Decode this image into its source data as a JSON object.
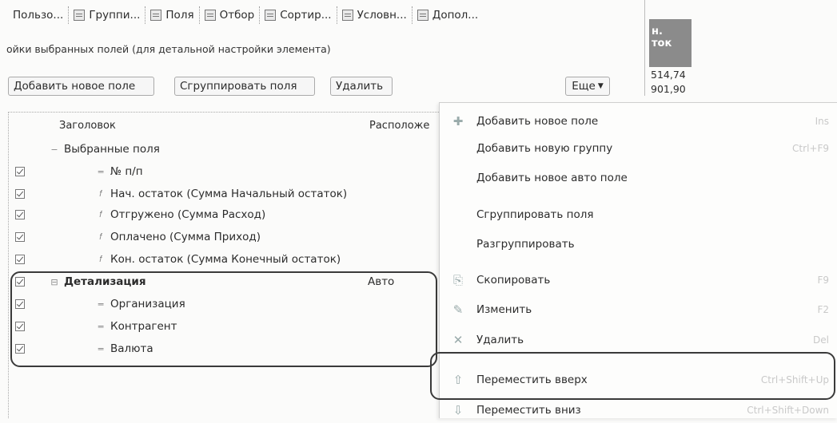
{
  "tabs": [
    {
      "label": "Пользо...",
      "icon": "user-icon"
    },
    {
      "label": "Группи...",
      "icon": "grouping-icon"
    },
    {
      "label": "Поля",
      "icon": "fields-icon"
    },
    {
      "label": "Отбор",
      "icon": "filter-icon"
    },
    {
      "label": "Сортир...",
      "icon": "sort-icon"
    },
    {
      "label": "Условн...",
      "icon": "conditional-icon"
    },
    {
      "label": "Допол...",
      "icon": "additional-icon"
    }
  ],
  "settings_caption": "ойки выбранных полей (для детальной настройки элемента)",
  "toolbar": {
    "add_label": "Добавить новое поле",
    "group_label": "Сгруппировать поля",
    "delete_label": "Удалить",
    "more_label": "Еще"
  },
  "mini_table": {
    "header_line1": "н.",
    "header_line2": "ток",
    "values": [
      "514,74",
      "901,90"
    ]
  },
  "tree": {
    "col_title": "Заголовок",
    "col_placement": "Расположе",
    "rows": [
      {
        "label": "Выбранные поля",
        "checked": false,
        "indent": 1,
        "icon": "minus",
        "placement": ""
      },
      {
        "label": "№ п/п",
        "checked": true,
        "indent": 2,
        "icon": "dash",
        "placement": ""
      },
      {
        "label": "Нач. остаток (Сумма Начальный остаток)",
        "checked": true,
        "indent": 2,
        "icon": "func",
        "placement": ""
      },
      {
        "label": "Отгружено (Сумма Расход)",
        "checked": true,
        "indent": 2,
        "icon": "func",
        "placement": ""
      },
      {
        "label": "Оплачено (Сумма Приход)",
        "checked": true,
        "indent": 2,
        "icon": "func",
        "placement": ""
      },
      {
        "label": "Кон. остаток (Сумма Конечный остаток)",
        "checked": true,
        "indent": 2,
        "icon": "func",
        "placement": ""
      },
      {
        "label": "Детализация",
        "checked": true,
        "indent": 1,
        "icon": "group",
        "placement": "Авто",
        "bold": true
      },
      {
        "label": "Организация",
        "checked": true,
        "indent": 2,
        "icon": "dash",
        "placement": ""
      },
      {
        "label": "Контрагент",
        "checked": true,
        "indent": 2,
        "icon": "dash",
        "placement": ""
      },
      {
        "label": "Валюта",
        "checked": true,
        "indent": 2,
        "icon": "dash",
        "placement": ""
      }
    ]
  },
  "menu": {
    "items": [
      {
        "label": "Добавить новое поле",
        "shortcut": "Ins",
        "icon": "add-field-icon"
      },
      {
        "label": "Добавить новую группу",
        "shortcut": "Ctrl+F9",
        "icon": ""
      },
      {
        "label": "Добавить новое авто поле",
        "shortcut": "",
        "icon": ""
      },
      {
        "label": "Сгруппировать поля",
        "shortcut": "",
        "icon": ""
      },
      {
        "label": "Разгруппировать",
        "shortcut": "",
        "icon": ""
      },
      {
        "label": "Скопировать",
        "shortcut": "F9",
        "icon": "copy-icon"
      },
      {
        "label": "Изменить",
        "shortcut": "F2",
        "icon": "edit-icon"
      },
      {
        "label": "Удалить",
        "shortcut": "Del",
        "icon": "delete-icon"
      },
      {
        "label": "Переместить вверх",
        "shortcut": "Ctrl+Shift+Up",
        "icon": "move-up-icon"
      },
      {
        "label": "Переместить вниз",
        "shortcut": "Ctrl+Shift+Down",
        "icon": "move-down-icon"
      }
    ]
  }
}
